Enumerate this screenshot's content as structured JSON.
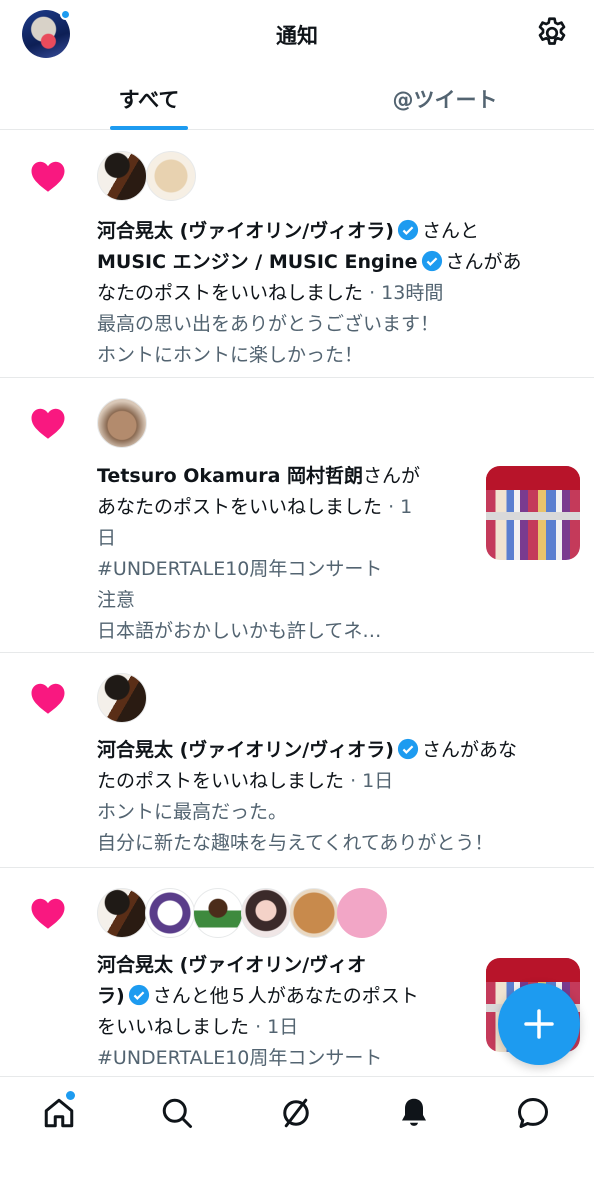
{
  "header": {
    "title": "通知"
  },
  "tabs": [
    {
      "label": "すべて",
      "selected": true
    },
    {
      "label": "@ツイート",
      "selected": false
    }
  ],
  "notifications": [
    {
      "line1_name": "河合晃太 (ヴァイオリン/ヴィオラ)",
      "line1_text": "さんと",
      "line2_name": "MUSIC エンジン / MUSIC Engine",
      "line2_text": "さんがあ",
      "line3_text": "なたのポストをいいねしました",
      "time": "· 13時間",
      "preview": [
        "最高の思い出をありがとうございます！",
        "ホントにホントに楽しかった！"
      ]
    },
    {
      "line1_name": "Tetsuro Okamura 岡村哲朗",
      "line1_text": "さんが",
      "line2_text": "あなたのポストをいいねしました",
      "line2_time": "· 1",
      "line3_time": "日",
      "preview": [
        "#UNDERTALE10周年コンサート",
        "注意",
        "日本語がおかしいかも許してネ…"
      ]
    },
    {
      "line1_name": "河合晃太 (ヴァイオリン/ヴィオラ)",
      "line1_text": "さんがあな",
      "line2_text": "たのポストをいいねしました",
      "time": "· 1日",
      "preview": [
        "ホントに最高だった。",
        "自分に新たな趣味を与えてくれてありがとう！"
      ]
    },
    {
      "line1_name": "河合晃太 (ヴァイオリン/ヴィオ",
      "line2_name": "ラ)",
      "line2_text": "さんと他５人があなたのポスト",
      "line3_text": "をいいねしました",
      "time": "· 1日",
      "preview": [
        "#UNDERTALE10周年コンサート"
      ]
    }
  ],
  "colors": {
    "accent": "#1d9bf0",
    "heart": "#f91880",
    "text": "#0f1419",
    "secondary": "#536471",
    "divider": "#e7e9ea"
  },
  "icons": {
    "settings": "gear-icon",
    "like": "heart-icon",
    "verified": "verified-badge-icon",
    "compose": "plus-icon",
    "nav": [
      "home-icon",
      "search-icon",
      "spaces-icon",
      "bell-icon",
      "messages-icon"
    ]
  }
}
